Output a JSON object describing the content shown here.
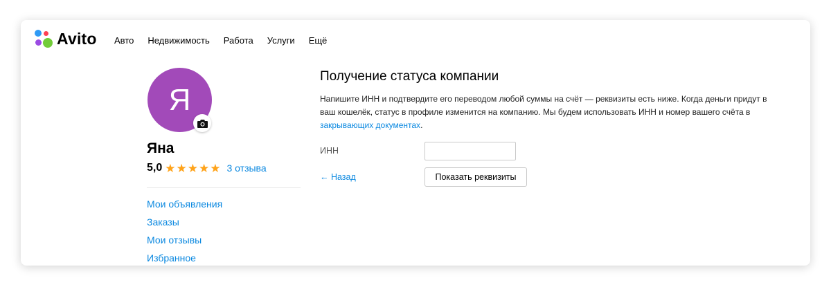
{
  "colors": {
    "accent_link": "#0a88e0",
    "avatar_bg": "#a24ab9",
    "star": "#ffa31a",
    "logo_blue": "#2f9af5",
    "logo_red": "#ff4053",
    "logo_purple": "#9b4be3",
    "logo_green": "#72cc39"
  },
  "header": {
    "logo_text": "Avito",
    "nav": [
      "Авто",
      "Недвижимость",
      "Работа",
      "Услуги",
      "Ещё"
    ]
  },
  "profile": {
    "avatar_letter": "Я",
    "camera_icon": "camera-icon",
    "name": "Яна",
    "rating": "5,0",
    "stars": 5,
    "reviews_link": "3 отзыва",
    "menu": [
      "Мои объявления",
      "Заказы",
      "Мои отзывы",
      "Избранное"
    ]
  },
  "main": {
    "title": "Получение статуса компании",
    "description_prefix": "Напишите ИНН и подтвердите его переводом любой суммы на счёт — реквизиты есть ниже. Когда деньги придут в ваш кошелёк, статус в профиле изменится на компанию. Мы будем использовать ИНН и номер вашего счёта в ",
    "description_link": "закрывающих документах",
    "description_suffix": ".",
    "inn_label": "ИНН",
    "inn_value": "",
    "back_link": "← Назад",
    "show_button": "Показать реквизиты"
  }
}
